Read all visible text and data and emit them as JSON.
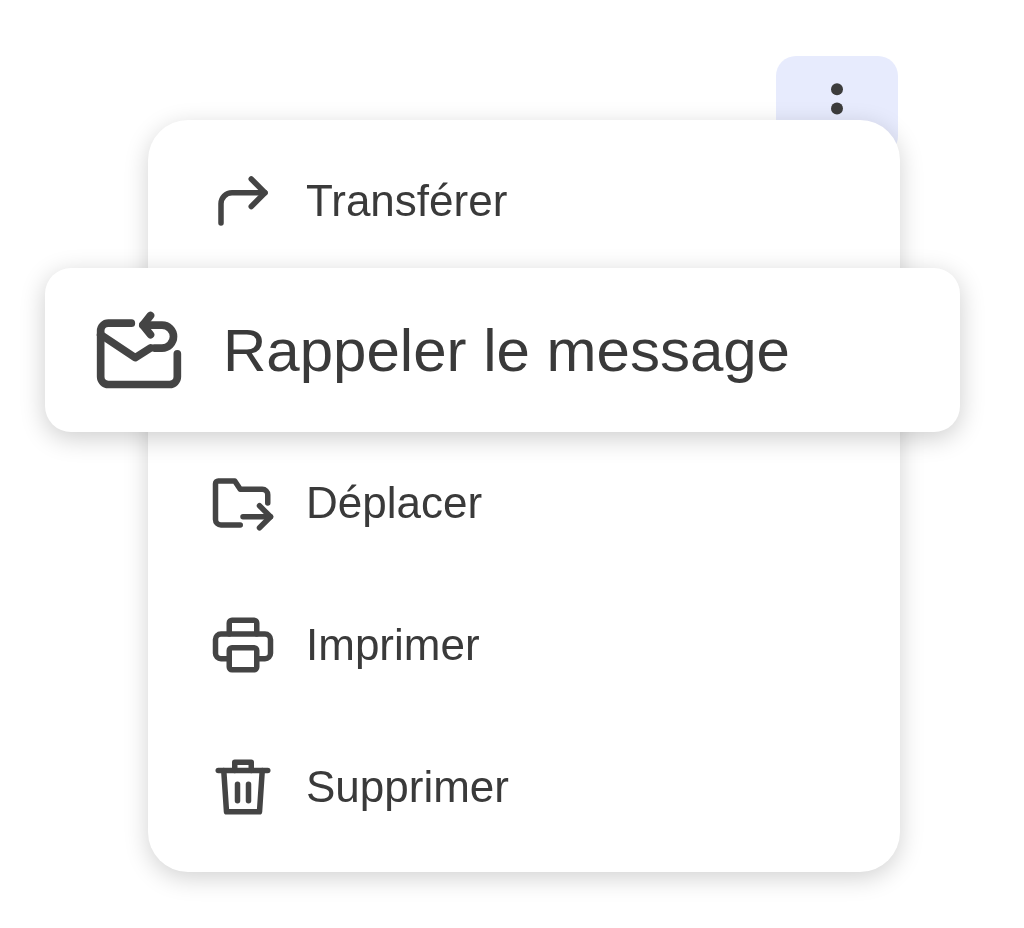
{
  "menu_button": {
    "expanded": true
  },
  "menu": {
    "items": [
      {
        "label": "Transférer",
        "highlighted": false
      },
      {
        "label": "Rappeler le message",
        "highlighted": true
      },
      {
        "label": "Déplacer",
        "highlighted": false
      },
      {
        "label": "Imprimer",
        "highlighted": false
      },
      {
        "label": "Supprimer",
        "highlighted": false
      }
    ]
  }
}
